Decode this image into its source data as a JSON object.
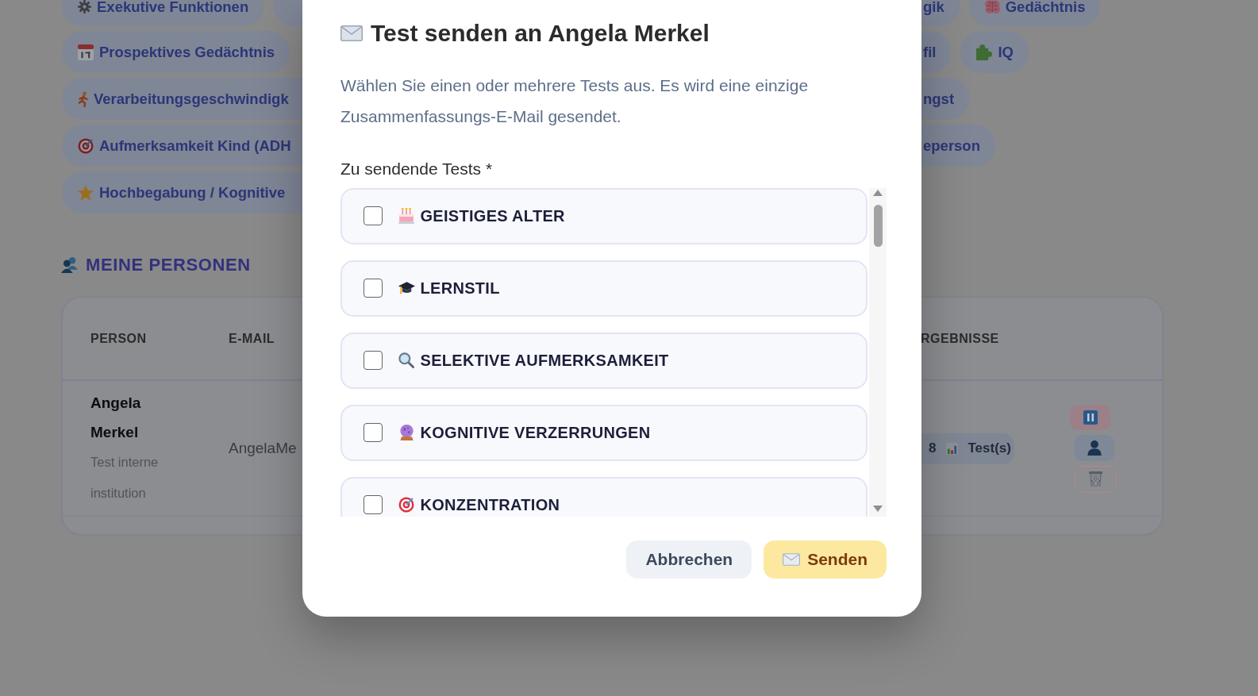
{
  "topic_chips": [
    {
      "left": [
        {
          "label": "Exekutive Funktionen",
          "kind": "whole"
        },
        {
          "kind": "fragment"
        }
      ],
      "right": [
        {
          "label": "gik",
          "kind": "cut_left"
        },
        {
          "label": "Gedächtnis",
          "kind": "whole"
        }
      ]
    },
    {
      "left": [
        {
          "label": "Prospektives Gedächtnis",
          "kind": "whole"
        }
      ],
      "right": [
        {
          "label": "fil",
          "kind": "cut_left"
        },
        {
          "label": "IQ",
          "kind": "whole"
        }
      ]
    },
    {
      "left": [
        {
          "label": "Verarbeitungsgeschwindigk",
          "kind": "cut_right"
        }
      ],
      "right": [
        {
          "label": "ngst",
          "kind": "cut_left"
        }
      ]
    },
    {
      "left": [
        {
          "label": "Aufmerksamkeit Kind (ADH",
          "kind": "cut_right"
        }
      ],
      "right": [
        {
          "label": "eperson",
          "kind": "cut_left"
        }
      ]
    },
    {
      "left": [
        {
          "label": "Hochbegabung / Kognitive",
          "kind": "cut_right"
        }
      ]
    }
  ],
  "people_section": {
    "title": "MEINE PERSONEN",
    "columns": [
      "PERSON",
      "E-MAIL",
      "RGEBNISSE"
    ],
    "rows": [
      {
        "name": "Angela Merkel",
        "institution": "Test interne institution",
        "email": "AngelaMe",
        "result_count": "8",
        "result_label": "Test(s)",
        "actions": [
          {
            "kind": "pause"
          },
          {
            "kind": "profile"
          },
          {
            "kind": "delete"
          }
        ]
      }
    ]
  },
  "send_dialog": {
    "title": "Test senden an Angela Merkel",
    "description": "Wählen Sie einen oder mehrere Tests aus. Es wird eine einzige Zusammenfassungs-E-Mail gesendet.",
    "field_label": "Zu sendende Tests *",
    "tests": [
      {
        "label": "GEISTIGES ALTER",
        "checked": false
      },
      {
        "label": "LERNSTIL",
        "checked": false
      },
      {
        "label": "SELEKTIVE AUFMERKSAMKEIT",
        "checked": false
      },
      {
        "label": "KOGNITIVE VERZERRUNGEN",
        "checked": false
      },
      {
        "label": "KONZENTRATION",
        "checked": false
      }
    ],
    "buttons": [
      {
        "label": "Abbrechen",
        "kind": "secondary"
      },
      {
        "label": "Senden",
        "kind": "primary"
      }
    ]
  }
}
